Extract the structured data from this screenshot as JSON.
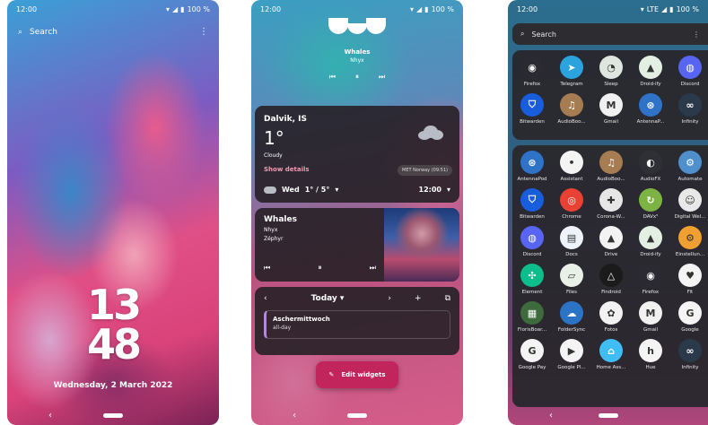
{
  "screens": {
    "lockscreen": {
      "status_time": "12:00",
      "status_battery": "100 %",
      "search_placeholder": "Search",
      "clock_hours": "13",
      "clock_minutes": "48",
      "date": "Wednesday, 2 March 2022"
    },
    "widgets": {
      "status_time": "12:00",
      "status_battery": "100 %",
      "music_top": {
        "title": "Whales",
        "artist": "Nhyx"
      },
      "weather": {
        "location": "Dalvik, IS",
        "temperature": "1°",
        "condition": "Cloudy",
        "details_link": "Show details",
        "source": "MET Norway (09:51)",
        "forecast_day": "Wed",
        "forecast_range": "1° / 5°",
        "forecast_time": "12:00"
      },
      "music_card": {
        "title": "Whales",
        "artist": "Nhyx",
        "album": "Zéphyr"
      },
      "calendar": {
        "view_label": "Today",
        "event_title": "Aschermittwoch",
        "event_time": "all-day"
      },
      "edit_button": "Edit widgets"
    },
    "drawer": {
      "status_time": "12:00",
      "status_network": "LTE",
      "status_battery": "100 %",
      "search_placeholder": "Search",
      "favorites": [
        {
          "name": "Firefox",
          "icon": "firefox-icon",
          "color": "#2b2a33",
          "glyph": "◉"
        },
        {
          "name": "Telegram",
          "icon": "telegram-icon",
          "color": "#2aa3df",
          "glyph": "➤"
        },
        {
          "name": "Sleep",
          "icon": "sleep-icon",
          "color": "#dfe6e0",
          "glyph": "◔"
        },
        {
          "name": "Droid-ify",
          "icon": "droidify-icon",
          "color": "#e3efe3",
          "glyph": "▲"
        },
        {
          "name": "Discord",
          "icon": "discord-icon",
          "color": "#5865f2",
          "glyph": "◍"
        },
        {
          "name": "Bitwarden",
          "icon": "bitwarden-icon",
          "color": "#175ddc",
          "glyph": "⛉"
        },
        {
          "name": "AudioBoo...",
          "icon": "audiobook-icon",
          "color": "#a67c52",
          "glyph": "♫"
        },
        {
          "name": "Gmail",
          "icon": "gmail-icon",
          "color": "#f1f1f1",
          "glyph": "M"
        },
        {
          "name": "AntennaP...",
          "icon": "antennapod-icon",
          "color": "#2e73c8",
          "glyph": "⊛"
        },
        {
          "name": "Infinity",
          "icon": "infinity-icon",
          "color": "#2a3a4a",
          "glyph": "∞"
        }
      ],
      "apps": [
        {
          "name": "AntennaPod",
          "icon": "antennapod-icon",
          "color": "#2e73c8",
          "glyph": "⊛"
        },
        {
          "name": "Assistant",
          "icon": "assistant-icon",
          "color": "#f4f4f4",
          "glyph": "•"
        },
        {
          "name": "AudioBoo...",
          "icon": "audiobook-icon",
          "color": "#a67c52",
          "glyph": "♫"
        },
        {
          "name": "AudioFX",
          "icon": "audiofx-icon",
          "color": "#2f2f36",
          "glyph": "◐"
        },
        {
          "name": "Automate",
          "icon": "automate-icon",
          "color": "#4f8fcc",
          "glyph": "⚙"
        },
        {
          "name": "Bitwarden",
          "icon": "bitwarden-icon",
          "color": "#175ddc",
          "glyph": "⛉"
        },
        {
          "name": "Chrome",
          "icon": "chrome-icon",
          "color": "#e94235",
          "glyph": "◎"
        },
        {
          "name": "Corona-W...",
          "icon": "corona-warn-icon",
          "color": "#e6e6e6",
          "glyph": "✚"
        },
        {
          "name": "DAVx⁵",
          "icon": "davx-icon",
          "color": "#7cb342",
          "glyph": "↻"
        },
        {
          "name": "Digital Wel...",
          "icon": "digital-wellbeing-icon",
          "color": "#e8e8e8",
          "glyph": "☺"
        },
        {
          "name": "Discord",
          "icon": "discord-icon",
          "color": "#5865f2",
          "glyph": "◍"
        },
        {
          "name": "Docs",
          "icon": "docs-icon",
          "color": "#eef2fb",
          "glyph": "▤"
        },
        {
          "name": "Drive",
          "icon": "drive-icon",
          "color": "#f3f3f3",
          "glyph": "▲"
        },
        {
          "name": "Droid-ify",
          "icon": "droidify-icon",
          "color": "#e3efe3",
          "glyph": "▲"
        },
        {
          "name": "Einstellun...",
          "icon": "settings-icon",
          "color": "#f0a030",
          "glyph": "⚙"
        },
        {
          "name": "Element",
          "icon": "element-icon",
          "color": "#0dbd8b",
          "glyph": "✣"
        },
        {
          "name": "Files",
          "icon": "files-icon",
          "color": "#e8f0e8",
          "glyph": "▱"
        },
        {
          "name": "Findroid",
          "icon": "findroid-icon",
          "color": "#1b1b1b",
          "glyph": "△"
        },
        {
          "name": "Firefox",
          "icon": "firefox-icon",
          "color": "#2b2a33",
          "glyph": "◉"
        },
        {
          "name": "Fit",
          "icon": "fit-icon",
          "color": "#f4f4f4",
          "glyph": "♥"
        },
        {
          "name": "FlorisBoar...",
          "icon": "florisboard-icon",
          "color": "#3e6b3e",
          "glyph": "▦"
        },
        {
          "name": "FolderSync",
          "icon": "foldersync-icon",
          "color": "#2b73c4",
          "glyph": "☁"
        },
        {
          "name": "Fotos",
          "icon": "photos-icon",
          "color": "#f2f2f2",
          "glyph": "✿"
        },
        {
          "name": "Gmail",
          "icon": "gmail-icon",
          "color": "#f1f1f1",
          "glyph": "M"
        },
        {
          "name": "Google",
          "icon": "google-icon",
          "color": "#f4f4f4",
          "glyph": "G"
        },
        {
          "name": "Google Pay",
          "icon": "google-pay-icon",
          "color": "#f4f4f4",
          "glyph": "G"
        },
        {
          "name": "Google Pl...",
          "icon": "google-play-icon",
          "color": "#f4f4f4",
          "glyph": "▶"
        },
        {
          "name": "Home Ass...",
          "icon": "home-assistant-icon",
          "color": "#41bdf5",
          "glyph": "⌂"
        },
        {
          "name": "Hue",
          "icon": "hue-icon",
          "color": "#f4f4f4",
          "glyph": "h"
        },
        {
          "name": "Infinity",
          "icon": "infinity-icon",
          "color": "#2a3a4a",
          "glyph": "∞"
        }
      ]
    }
  }
}
